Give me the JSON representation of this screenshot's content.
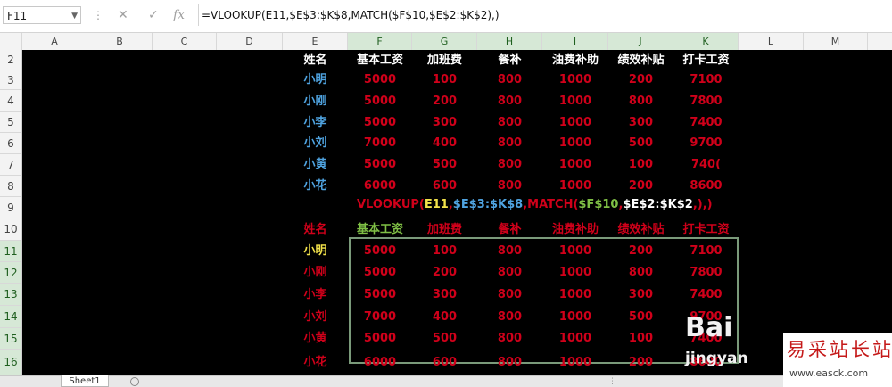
{
  "formula_bar": {
    "name_box": "F11",
    "dots": "⋮",
    "cancel_icon": "✕",
    "confirm_icon": "✓",
    "fx_label": "fx",
    "formula": "=VLOOKUP(E11,$E$3:$K$8,MATCH($F$10,$E$2:$K$2),)"
  },
  "columns": [
    "A",
    "B",
    "C",
    "D",
    "E",
    "F",
    "G",
    "H",
    "I",
    "J",
    "K",
    "L",
    "M"
  ],
  "rows": [
    "2",
    "3",
    "4",
    "5",
    "6",
    "7",
    "8",
    "9",
    "10",
    "11",
    "12",
    "13",
    "14",
    "15",
    "16"
  ],
  "upper_table": {
    "headers": [
      "姓名",
      "基本工资",
      "加班费",
      "餐补",
      "油费补助",
      "绩效补贴",
      "打卡工资"
    ],
    "rows": [
      {
        "name": "小明",
        "values": [
          "5000",
          "100",
          "800",
          "1000",
          "200",
          "7100"
        ]
      },
      {
        "name": "小刚",
        "values": [
          "5000",
          "200",
          "800",
          "1000",
          "800",
          "7800"
        ]
      },
      {
        "name": "小李",
        "values": [
          "5000",
          "300",
          "800",
          "1000",
          "300",
          "7400"
        ]
      },
      {
        "name": "小刘",
        "values": [
          "7000",
          "400",
          "800",
          "1000",
          "500",
          "9700"
        ]
      },
      {
        "name": "小黄",
        "values": [
          "5000",
          "500",
          "800",
          "1000",
          "100",
          "740("
        ]
      },
      {
        "name": "小花",
        "values": [
          "6000",
          "600",
          "800",
          "1000",
          "200",
          "8600"
        ]
      }
    ]
  },
  "formula_display": {
    "p1": "VLOOKUP(",
    "p2": "E11",
    "p3": ",",
    "p4": "$E$3:$K$8",
    "p5": ",MATCH(",
    "p6": "$F$10",
    "p7": ",",
    "p8": "$E$2:$K$2",
    "p9": ",),)"
  },
  "lower_table": {
    "headers": [
      "姓名",
      "基本工资",
      "加班费",
      "餐补",
      "油费补助",
      "绩效补贴",
      "打卡工资"
    ],
    "rows": [
      {
        "name": "小明",
        "values": [
          "5000",
          "100",
          "800",
          "1000",
          "200",
          "7100"
        ]
      },
      {
        "name": "小刚",
        "values": [
          "5000",
          "200",
          "800",
          "1000",
          "800",
          "7800"
        ]
      },
      {
        "name": "小李",
        "values": [
          "5000",
          "300",
          "800",
          "1000",
          "300",
          "7400"
        ]
      },
      {
        "name": "小刘",
        "values": [
          "7000",
          "400",
          "800",
          "1000",
          "500",
          "9700"
        ]
      },
      {
        "name": "小黄",
        "values": [
          "5000",
          "500",
          "800",
          "1000",
          "100",
          "7400"
        ]
      },
      {
        "name": "小花",
        "values": [
          "6000",
          "600",
          "800",
          "1000",
          "200",
          "8600"
        ]
      }
    ]
  },
  "sheet_tab": "Sheet1",
  "watermark": {
    "bai": "Bai",
    "jingyan": "jingyan",
    "site_title": "易采站长站",
    "site_url": "www.easck.com"
  },
  "colors": {
    "background": "#000000",
    "header_white": "#ffffff",
    "name_blue": "#4fa3e0",
    "value_red": "#d0001a",
    "highlight_yellow": "#f2e24a",
    "highlight_green": "#7fbf45"
  }
}
